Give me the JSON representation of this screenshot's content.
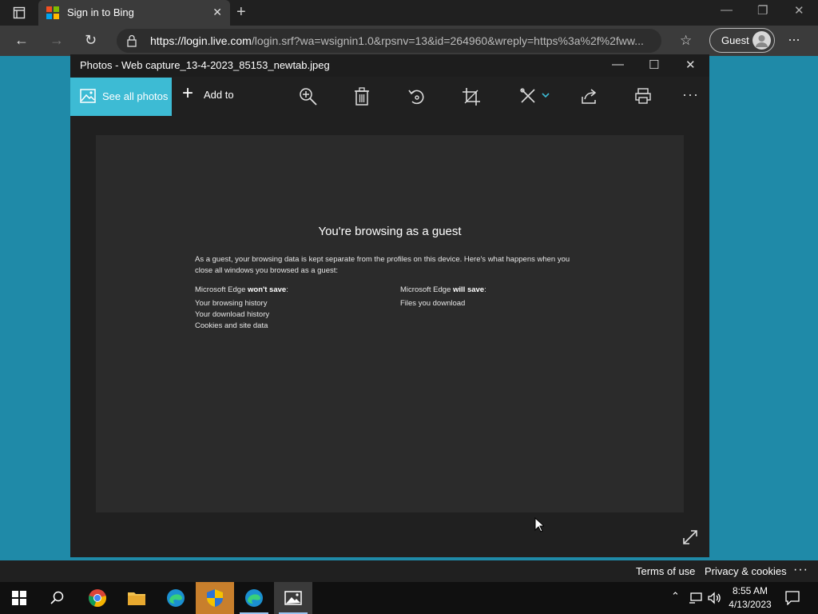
{
  "browser": {
    "tab_title": "Sign in to Bing",
    "url_host": "https://login.live.com",
    "url_rest": "/login.srf?wa=wsignin1.0&rpsnv=13&id=264960&wreply=https%3a%2f%2fww...",
    "profile_label": "Guest"
  },
  "photos": {
    "window_title": "Photos - Web capture_13-4-2023_85153_newtab.jpeg",
    "see_all_label": "See all photos",
    "add_to_label": "Add to"
  },
  "capture": {
    "heading": "You're browsing as a guest",
    "paragraph": "As a guest, your browsing data is kept separate from the profiles on this device. Here's what happens when you close all windows you browsed as a guest:",
    "wont_save_prefix": "Microsoft Edge ",
    "wont_save_bold": "won't save",
    "wont_save_suffix": ":",
    "wont_save_items": [
      "Your browsing history",
      "Your download history",
      "Cookies and site data"
    ],
    "will_save_prefix": "Microsoft Edge ",
    "will_save_bold": "will save",
    "will_save_suffix": ":",
    "will_save_items": [
      "Files you download"
    ]
  },
  "footer": {
    "terms": "Terms of use",
    "privacy": "Privacy & cookies"
  },
  "taskbar": {
    "time": "8:55 AM",
    "date": "4/13/2023"
  },
  "colors": {
    "desktop": "#1f8aa8",
    "accent": "#3dbbd4",
    "window_bg": "#202020"
  }
}
